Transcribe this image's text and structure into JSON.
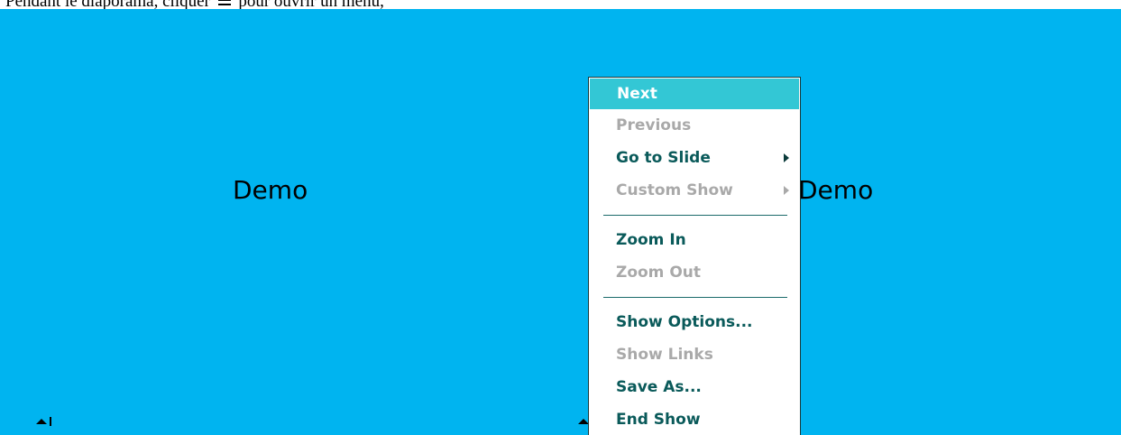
{
  "caption": {
    "text_before": "Pendant le diaporama, cliquer",
    "icon": "menu-icon",
    "text_after": "pour ouvrir un menu,"
  },
  "slide": {
    "background": "#00b4f0",
    "left_text": "Demo",
    "right_text": "Demo"
  },
  "context_menu": {
    "highlight_color": "#33c7d5",
    "text_color": "#0a5a5a",
    "disabled_color": "#a9a9a9",
    "items": [
      {
        "label": "Next"
      },
      {
        "label": "Previous"
      },
      {
        "label": "Go to Slide"
      },
      {
        "label": "Custom Show"
      },
      {
        "label": "Zoom In"
      },
      {
        "label": "Zoom Out"
      },
      {
        "label": "Show Options..."
      },
      {
        "label": "Show Links"
      },
      {
        "label": "Save As..."
      },
      {
        "label": "End Show"
      }
    ]
  }
}
